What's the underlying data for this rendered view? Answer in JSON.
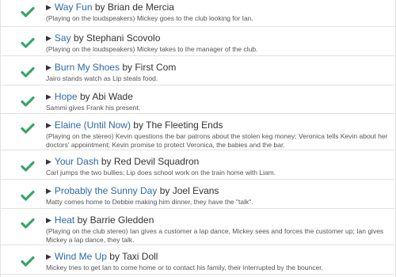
{
  "songs": [
    {
      "title": "Way Fun",
      "by": "by",
      "artist": "Brian de Mercia",
      "description": "(Playing on the loudspeakers) Mickey goes to the club looking for Ian."
    },
    {
      "title": "Say",
      "by": "by",
      "artist": "Stephani Scovolo",
      "description": "(Playing on the loudspeakers) Mickey takes to the manager of the club."
    },
    {
      "title": "Burn My Shoes",
      "by": "by",
      "artist": "First Com",
      "description": "Jairo stands watch as Lip steals food."
    },
    {
      "title": "Hope",
      "by": "by",
      "artist": "Abi Wade",
      "description": "Sammi gives Frank his present."
    },
    {
      "title": "Elaine (Until Now)",
      "by": "by",
      "artist": "The Fleeting Ends",
      "description": "(Playing on the stereo) Kevin questions the bar patrons about the stolen keg money; Veronica tells Kevin about her doctors' appointment; Kevin promise to protect Veronica, the babies and the bar."
    },
    {
      "title": "Your Dash",
      "by": "by",
      "artist": "Red Devil Squadron",
      "description": "Carl jumps the two bullies; Lip does school work on the train home with Liam."
    },
    {
      "title": "Probably the Sunny Day",
      "by": "by",
      "artist": "Joel Evans",
      "description": "Matty comes home to Debbie making him dinner, they have the \"talk\"."
    },
    {
      "title": "Heat",
      "by": "by",
      "artist": "Barrie Gledden",
      "description": "(Playing on the club stereo) Ian gives a customer a lap dance, Mickey sees and forces the customer up; Ian gives Mickey a lap dance, they talk."
    },
    {
      "title": "Wind Me Up",
      "by": "by",
      "artist": "Taxi Doll",
      "description": "Mickey tries to get Ian to come home or to contact his family, their interrupted by the bouncer."
    }
  ],
  "colors": {
    "check": "#3aa468",
    "link": "#2b6aa9",
    "border": "#e2e2e2"
  },
  "icons": {
    "status": "check-icon",
    "play": "play-icon"
  }
}
